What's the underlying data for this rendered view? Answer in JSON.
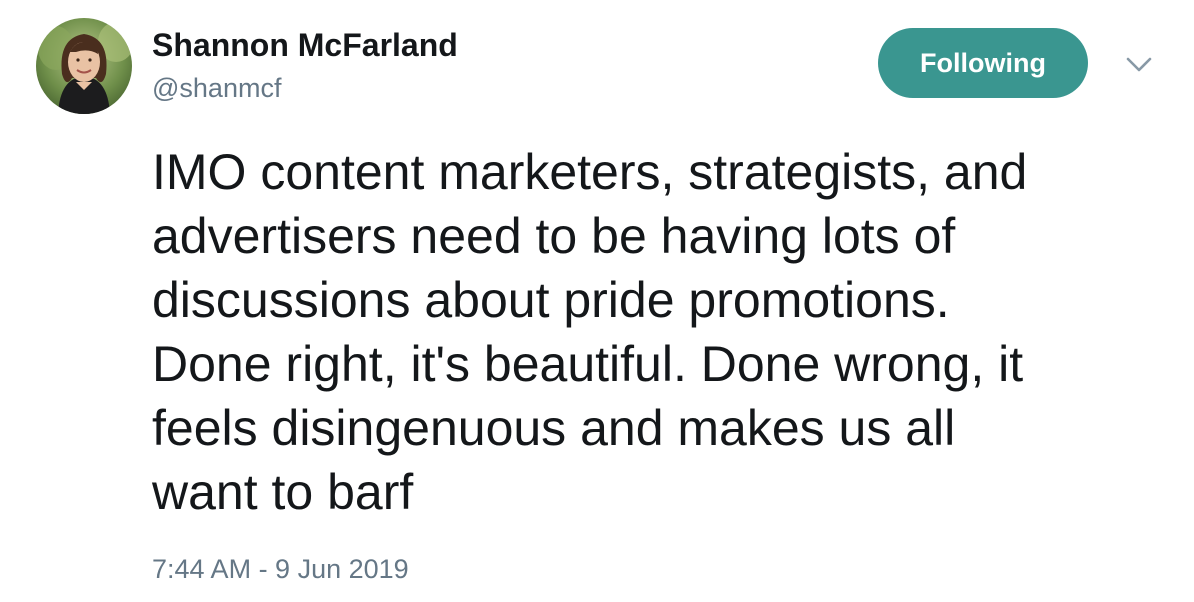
{
  "author": {
    "display_name": "Shannon McFarland",
    "handle": "@shanmcf"
  },
  "follow_button": {
    "label": "Following",
    "color": "#3a9690"
  },
  "tweet": {
    "lines": [
      "IMO content marketers, strategists, and",
      "advertisers need to be having lots of",
      "discussions about pride promotions.",
      "Done right, it's beautiful. Done wrong, it",
      "feels disingenuous and makes us all",
      "want to barf"
    ],
    "timestamp": "7:44 AM - 9 Jun 2019"
  },
  "icons": {
    "menu": "chevron-down-icon",
    "avatar": "profile-photo"
  }
}
